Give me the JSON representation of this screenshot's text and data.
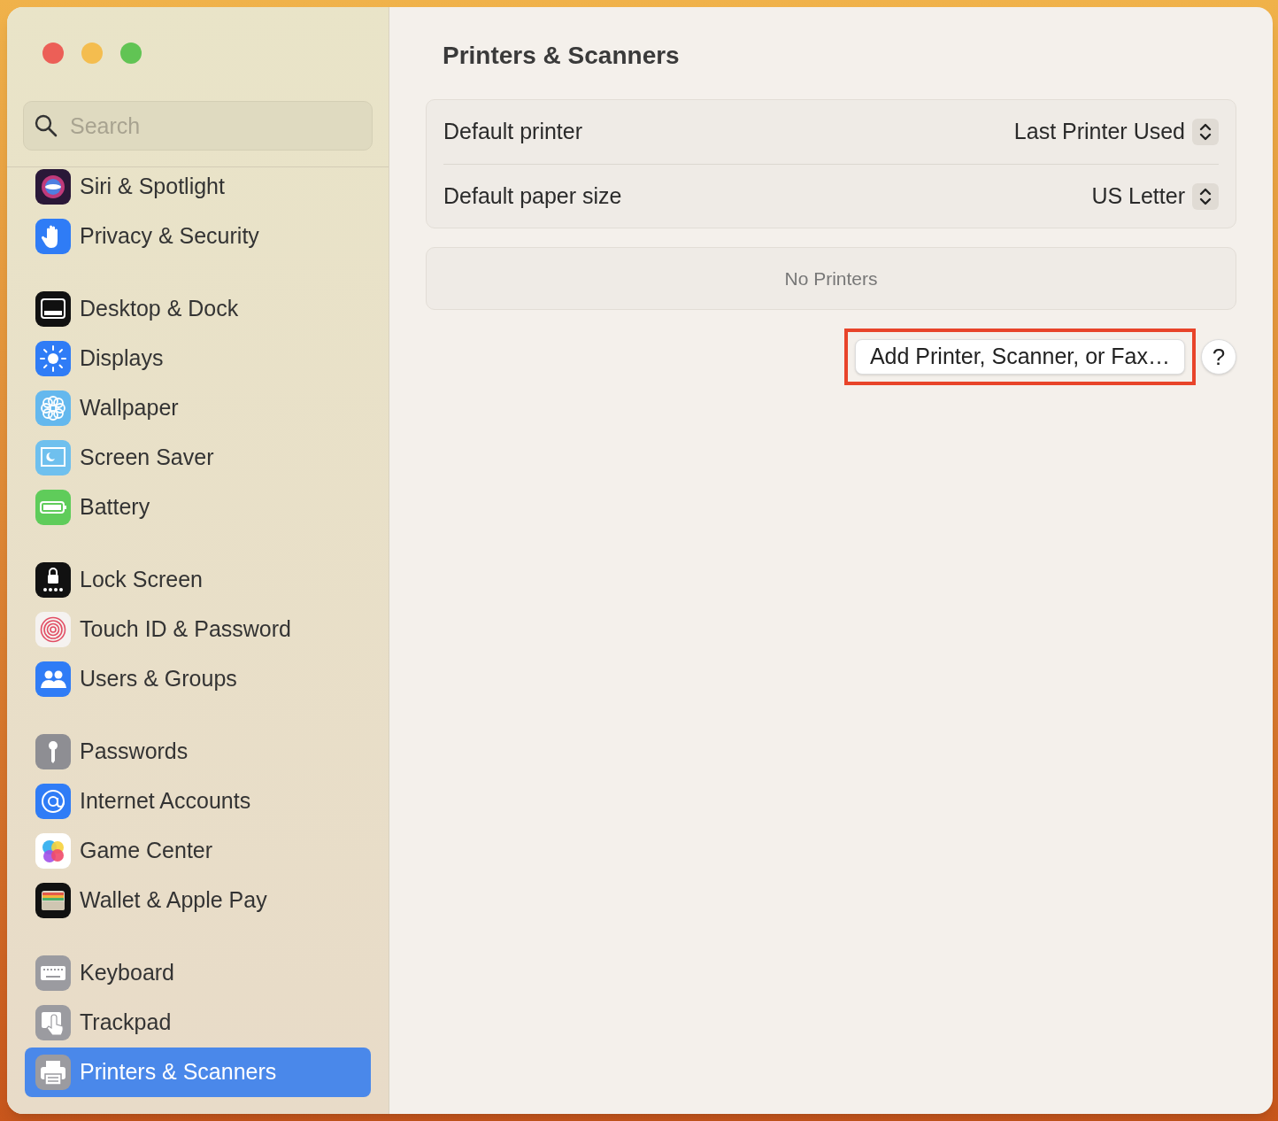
{
  "sidebar": {
    "search": {
      "placeholder": "Search"
    },
    "groups": [
      [
        {
          "label": "Siri & Spotlight",
          "selected": false
        },
        {
          "label": "Privacy & Security",
          "selected": false
        }
      ],
      [
        {
          "label": "Desktop & Dock",
          "selected": false
        },
        {
          "label": "Displays",
          "selected": false
        },
        {
          "label": "Wallpaper",
          "selected": false
        },
        {
          "label": "Screen Saver",
          "selected": false
        },
        {
          "label": "Battery",
          "selected": false
        }
      ],
      [
        {
          "label": "Lock Screen",
          "selected": false
        },
        {
          "label": "Touch ID & Password",
          "selected": false
        },
        {
          "label": "Users & Groups",
          "selected": false
        }
      ],
      [
        {
          "label": "Passwords",
          "selected": false
        },
        {
          "label": "Internet Accounts",
          "selected": false
        },
        {
          "label": "Game Center",
          "selected": false
        },
        {
          "label": "Wallet & Apple Pay",
          "selected": false
        }
      ],
      [
        {
          "label": "Keyboard",
          "selected": false
        },
        {
          "label": "Trackpad",
          "selected": false
        },
        {
          "label": "Printers & Scanners",
          "selected": true
        }
      ]
    ]
  },
  "content": {
    "title": "Printers & Scanners",
    "settings": [
      {
        "label": "Default printer",
        "value": "Last Printer Used"
      },
      {
        "label": "Default paper size",
        "value": "US Letter"
      }
    ],
    "printers_list": {
      "empty_text": "No Printers"
    },
    "add_button": {
      "label": "Add Printer, Scanner, or Fax…",
      "highlighted": true
    },
    "help_button": {
      "label": "?"
    }
  }
}
